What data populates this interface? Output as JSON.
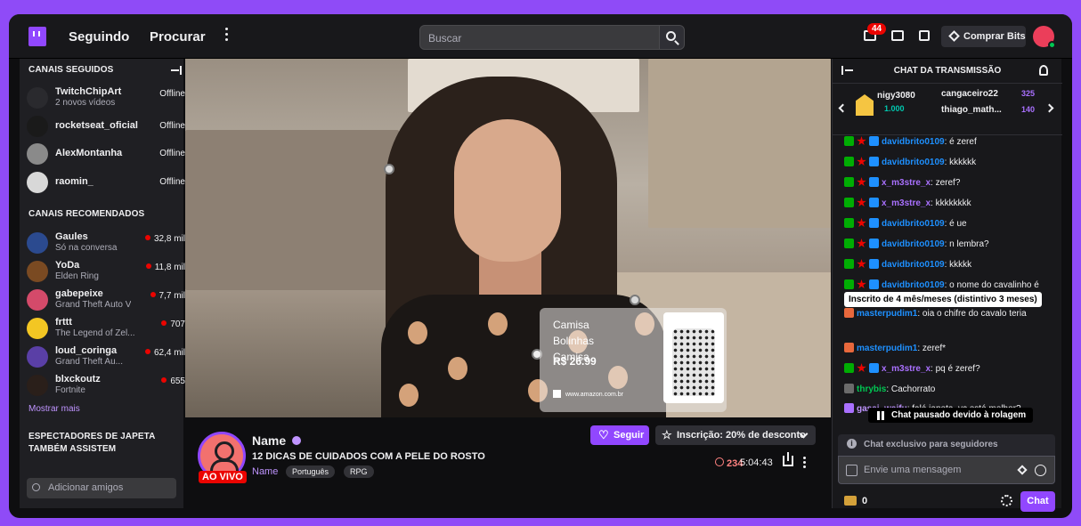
{
  "nav": {
    "following": "Seguindo",
    "browse": "Procurar",
    "search_placeholder": "Buscar",
    "notifications_count": "44",
    "get_bits": "Comprar Bits"
  },
  "sidebar": {
    "followed_title": "CANAIS SEGUIDOS",
    "followed": [
      {
        "name": "TwitchChipArt",
        "sub": "2 novos vídeos",
        "status": "Offline"
      },
      {
        "name": "rocketseat_oficial",
        "sub": "",
        "status": "Offline"
      },
      {
        "name": "AlexMontanha",
        "sub": "",
        "status": "Offline"
      },
      {
        "name": "raomin_",
        "sub": "",
        "status": "Offline"
      }
    ],
    "recommended_title": "CANAIS RECOMENDADOS",
    "recommended": [
      {
        "name": "Gaules",
        "sub": "Só na conversa",
        "viewers": "32,8 mil"
      },
      {
        "name": "YoDa",
        "sub": "Elden Ring",
        "viewers": "11,8 mil"
      },
      {
        "name": "gabepeixe",
        "sub": "Grand Theft Auto V",
        "viewers": "7,7 mil"
      },
      {
        "name": "frttt",
        "sub": "The Legend of Zel...",
        "viewers": "707"
      },
      {
        "name": "loud_coringa",
        "sub": "Grand Theft Au...",
        "viewers": "62,4 mil"
      },
      {
        "name": "blxckoutz",
        "sub": "Fortnite",
        "viewers": "655"
      }
    ],
    "show_more": "Mostrar mais",
    "viewers_also_title_1": "ESPECTADORES DE JAPETA",
    "viewers_also_title_2": "TAMBÉM ASSISTEM",
    "add_friends": "Adicionar amigos"
  },
  "product": {
    "title": "Camisa Bolinhas Camisa",
    "price": "R$ 26.99",
    "url": "www.amazon.com.br"
  },
  "stream": {
    "name": "Name",
    "title": "12 DICAS DE CUIDADOS COM A PELE DO ROSTO",
    "category": "Name",
    "tags": [
      "Português",
      "RPG"
    ],
    "live": "AO VIVO",
    "follow": "Seguir",
    "subscribe": "Inscrição: 20% de desconto",
    "viewers": "234",
    "uptime": "5:04:43"
  },
  "chat": {
    "title": "CHAT DA TRANSMISSÃO",
    "leaderboard": [
      {
        "name": "nigy3080",
        "value": "1.000",
        "color": "#00c8af"
      },
      {
        "name": "cangaceiro22",
        "value": "325",
        "color": "#a970ff"
      },
      {
        "name": "thiago_math...",
        "value": "140",
        "color": "#a970ff"
      }
    ],
    "messages": [
      {
        "badges": [
          "g",
          "r",
          "bl"
        ],
        "user": "davidbrito0109",
        "color": "#1e90ff",
        "text": ": é zeref"
      },
      {
        "badges": [
          "g",
          "r",
          "bl"
        ],
        "user": "davidbrito0109",
        "color": "#1e90ff",
        "text": ": kkkkkk"
      },
      {
        "badges": [
          "g",
          "r",
          "bl"
        ],
        "user": "x_m3stre_x",
        "color": "#a970ff",
        "text": ": zeref?"
      },
      {
        "badges": [
          "g",
          "r",
          "bl"
        ],
        "user": "x_m3stre_x",
        "color": "#a970ff",
        "text": ": kkkkkkkk"
      },
      {
        "badges": [
          "g",
          "r",
          "bl"
        ],
        "user": "davidbrito0109",
        "color": "#1e90ff",
        "text": ": é ue"
      },
      {
        "badges": [
          "g",
          "r",
          "bl"
        ],
        "user": "davidbrito0109",
        "color": "#1e90ff",
        "text": ": n lembra?"
      },
      {
        "badges": [
          "g",
          "r",
          "bl"
        ],
        "user": "davidbrito0109",
        "color": "#1e90ff",
        "text": ": kkkkk"
      },
      {
        "badges": [
          "g",
          "r",
          "bl"
        ],
        "user": "davidbrito0109",
        "color": "#1e90ff",
        "text": ": o nome do cavalinho é zeref"
      },
      {
        "badges": [
          "o"
        ],
        "user": "masterpudim1",
        "color": "#1e90ff",
        "text": ": oia o chifre do cavalo teria"
      },
      {
        "badges": [
          "o"
        ],
        "user": "masterpudim1",
        "color": "#1e90ff",
        "text": ": zeref*"
      },
      {
        "badges": [
          "g",
          "r",
          "bl"
        ],
        "user": "x_m3stre_x",
        "color": "#a970ff",
        "text": ": pq é zeref?"
      },
      {
        "badges": [
          "gr"
        ],
        "user": "thrybis",
        "color": "#00c853",
        "text": ": Cachorrato"
      },
      {
        "badges": [
          "p"
        ],
        "user": "gasai_waifu",
        "color": "#bf94ff",
        "text": ": falá japeta, vc está melhor?"
      }
    ],
    "tooltip": "Inscrito de 4 mês/meses (distintivo 3 meses)",
    "paused": "Chat pausado devido à rolagem",
    "followers_only": "Chat exclusivo para seguidores",
    "input_placeholder": "Envie uma mensagem",
    "points": "0",
    "send": "Chat"
  }
}
